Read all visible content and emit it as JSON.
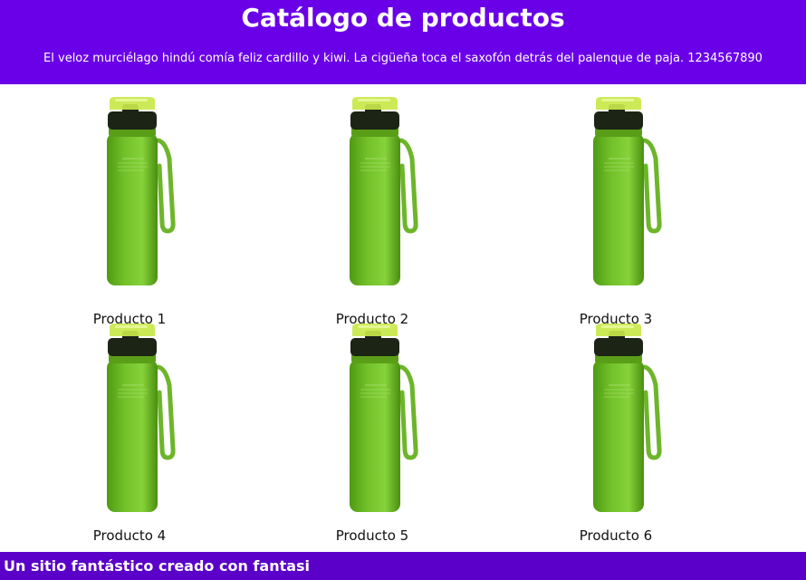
{
  "header": {
    "title": "Catálogo de productos",
    "tagline": "El veloz murciélago hindú comía feliz cardillo y kiwi. La cigüeña toca el saxofón detrás del palenque de paja. 1234567890"
  },
  "products": [
    {
      "name": "Producto 1"
    },
    {
      "name": "Producto 2"
    },
    {
      "name": "Producto 3"
    },
    {
      "name": "Producto 4"
    },
    {
      "name": "Producto 5"
    },
    {
      "name": "Producto 6"
    }
  ],
  "footer": {
    "text": "Un sitio fantástico creado con fantasi"
  },
  "colors": {
    "header_bg": "#6a00e8",
    "footer_bg": "#5a00c8",
    "bottle_body": "#72c12a",
    "bottle_cap": "#1c2416",
    "bottle_lid": "#c8e84a"
  }
}
